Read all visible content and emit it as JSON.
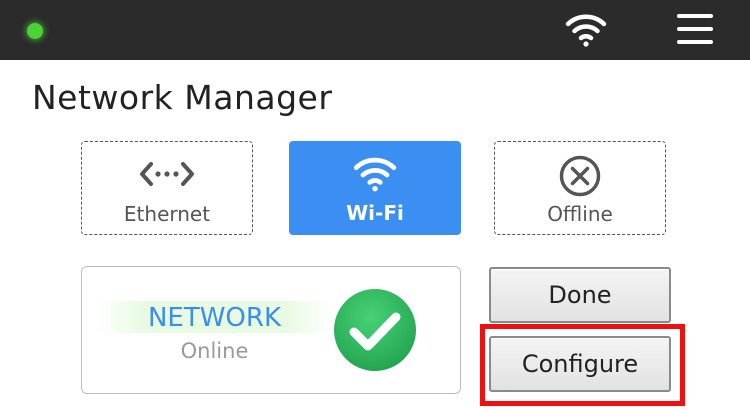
{
  "topbar": {
    "status_indicator_color": "#4cd137",
    "wifi_icon": "wifi-icon",
    "menu_icon": "hamburger-menu-icon"
  },
  "page": {
    "title": "Network Manager"
  },
  "modes": [
    {
      "label": "Ethernet",
      "icon": "ethernet-icon",
      "active": false
    },
    {
      "label": "Wi-Fi",
      "icon": "wifi-icon",
      "active": true
    },
    {
      "label": "Offline",
      "icon": "offline-x-circle-icon",
      "active": false
    }
  ],
  "status": {
    "name": "NETWORK",
    "value": "Online",
    "icon": "check-circle-icon",
    "icon_color": "#2dbd5e"
  },
  "actions": {
    "done_label": "Done",
    "configure_label": "Configure"
  },
  "colors": {
    "accent": "#3b8ff2",
    "highlight": "#ee1111"
  }
}
